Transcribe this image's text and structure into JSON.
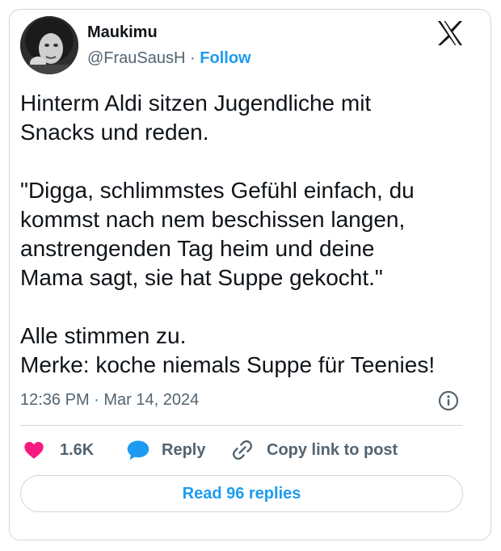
{
  "author": {
    "name": "Maukimu",
    "handle": "@FrauSausH",
    "separator": "·",
    "follow_label": "Follow"
  },
  "tweet": {
    "text": "Hinterm Aldi sitzen Jugendliche mit\nSnacks und reden.\n\n\"Digga, schlimmstes Gefühl einfach, du\nkommst nach nem beschissen langen,\nanstrengenden Tag heim und deine\nMama sagt, sie hat Suppe gekocht.\"\n\nAlle stimmen zu.\nMerke: koche niemals Suppe für Teenies!",
    "timestamp": "12:36 PM · Mar 14, 2024"
  },
  "actions": {
    "like_count": "1.6K",
    "reply_label": "Reply",
    "copy_label": "Copy link to post"
  },
  "read_replies_label": "Read 96 replies",
  "icons": {
    "logo": "x-logo-icon",
    "info": "info-icon",
    "like": "heart-icon",
    "reply": "speech-bubble-icon",
    "copy": "link-icon"
  },
  "colors": {
    "accent": "#1d9bf0",
    "like": "#f91880",
    "text": "#0f1419",
    "secondary": "#536471",
    "border": "#cfd9de"
  }
}
